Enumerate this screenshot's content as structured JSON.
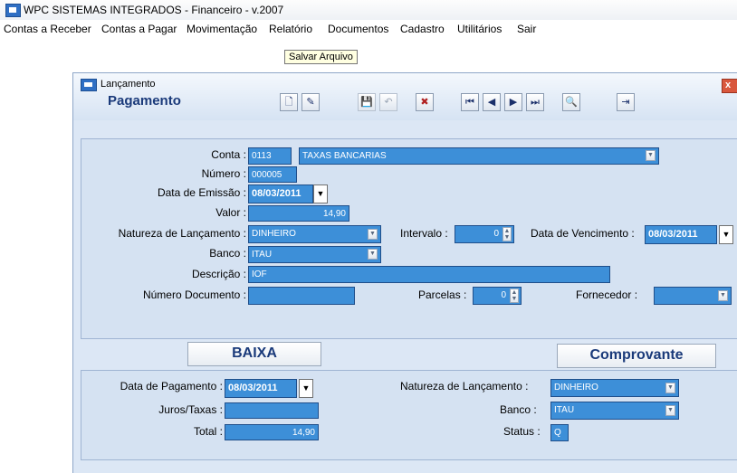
{
  "app": {
    "title": "WPC SISTEMAS INTEGRADOS - Financeiro - v.2007"
  },
  "menu": [
    "Contas a Receber",
    "Contas a Pagar",
    "Movimentação",
    "Relatório",
    "Documentos",
    "Cadastro",
    "Utilitários",
    "Sair"
  ],
  "window": {
    "title": "Lançamento",
    "heading": "Pagamento",
    "tooltip": "Salvar Arquivo"
  },
  "toolbar": {
    "new": "🗋",
    "edit": "✎",
    "save": "💾",
    "undo": "↶",
    "delete": "✖",
    "first": "⏮",
    "prev": "◀",
    "next": "▶",
    "last": "⏭",
    "search": "🔍",
    "exit": "⇥"
  },
  "form": {
    "conta": {
      "label": "Conta :",
      "code": "0113",
      "name": "TAXAS BANCARIAS"
    },
    "numero": {
      "label": "Número :",
      "value": "000005"
    },
    "data_emissao": {
      "label": "Data de Emissão :",
      "value": "08/03/2011"
    },
    "valor": {
      "label": "Valor :",
      "value": "14,90"
    },
    "natureza": {
      "label": "Natureza de Lançamento :",
      "value": "DINHEIRO"
    },
    "intervalo": {
      "label": "Intervalo :",
      "value": "0"
    },
    "data_vencimento": {
      "label": "Data de Vencimento :",
      "value": "08/03/2011"
    },
    "banco": {
      "label": "Banco :",
      "value": "ITAU"
    },
    "descricao": {
      "label": "Descrição :",
      "value": "IOF"
    },
    "numero_documento": {
      "label": "Número Documento :",
      "value": ""
    },
    "parcelas": {
      "label": "Parcelas :",
      "value": "0"
    },
    "fornecedor": {
      "label": "Fornecedor :",
      "value": ""
    }
  },
  "buttons": {
    "baixa": "BAIXA",
    "comprovante": "Comprovante"
  },
  "baixa": {
    "data_pagamento": {
      "label": "Data de Pagamento :",
      "value": "08/03/2011"
    },
    "juros": {
      "label": "Juros/Taxas :",
      "value": ""
    },
    "total": {
      "label": "Total :",
      "value": "14,90"
    },
    "natureza": {
      "label": "Natureza de Lançamento :",
      "value": "DINHEIRO"
    },
    "banco": {
      "label": "Banco :",
      "value": "ITAU"
    },
    "status": {
      "label": "Status :",
      "value": "Q"
    }
  },
  "glyphs": {
    "dropdown": "▼",
    "spin_up": "▲",
    "spin_down": "▼",
    "close": "x"
  },
  "colors": {
    "field": "#3d8fd8",
    "panel": "#d5e2f2",
    "heading": "#1a3a7a"
  }
}
